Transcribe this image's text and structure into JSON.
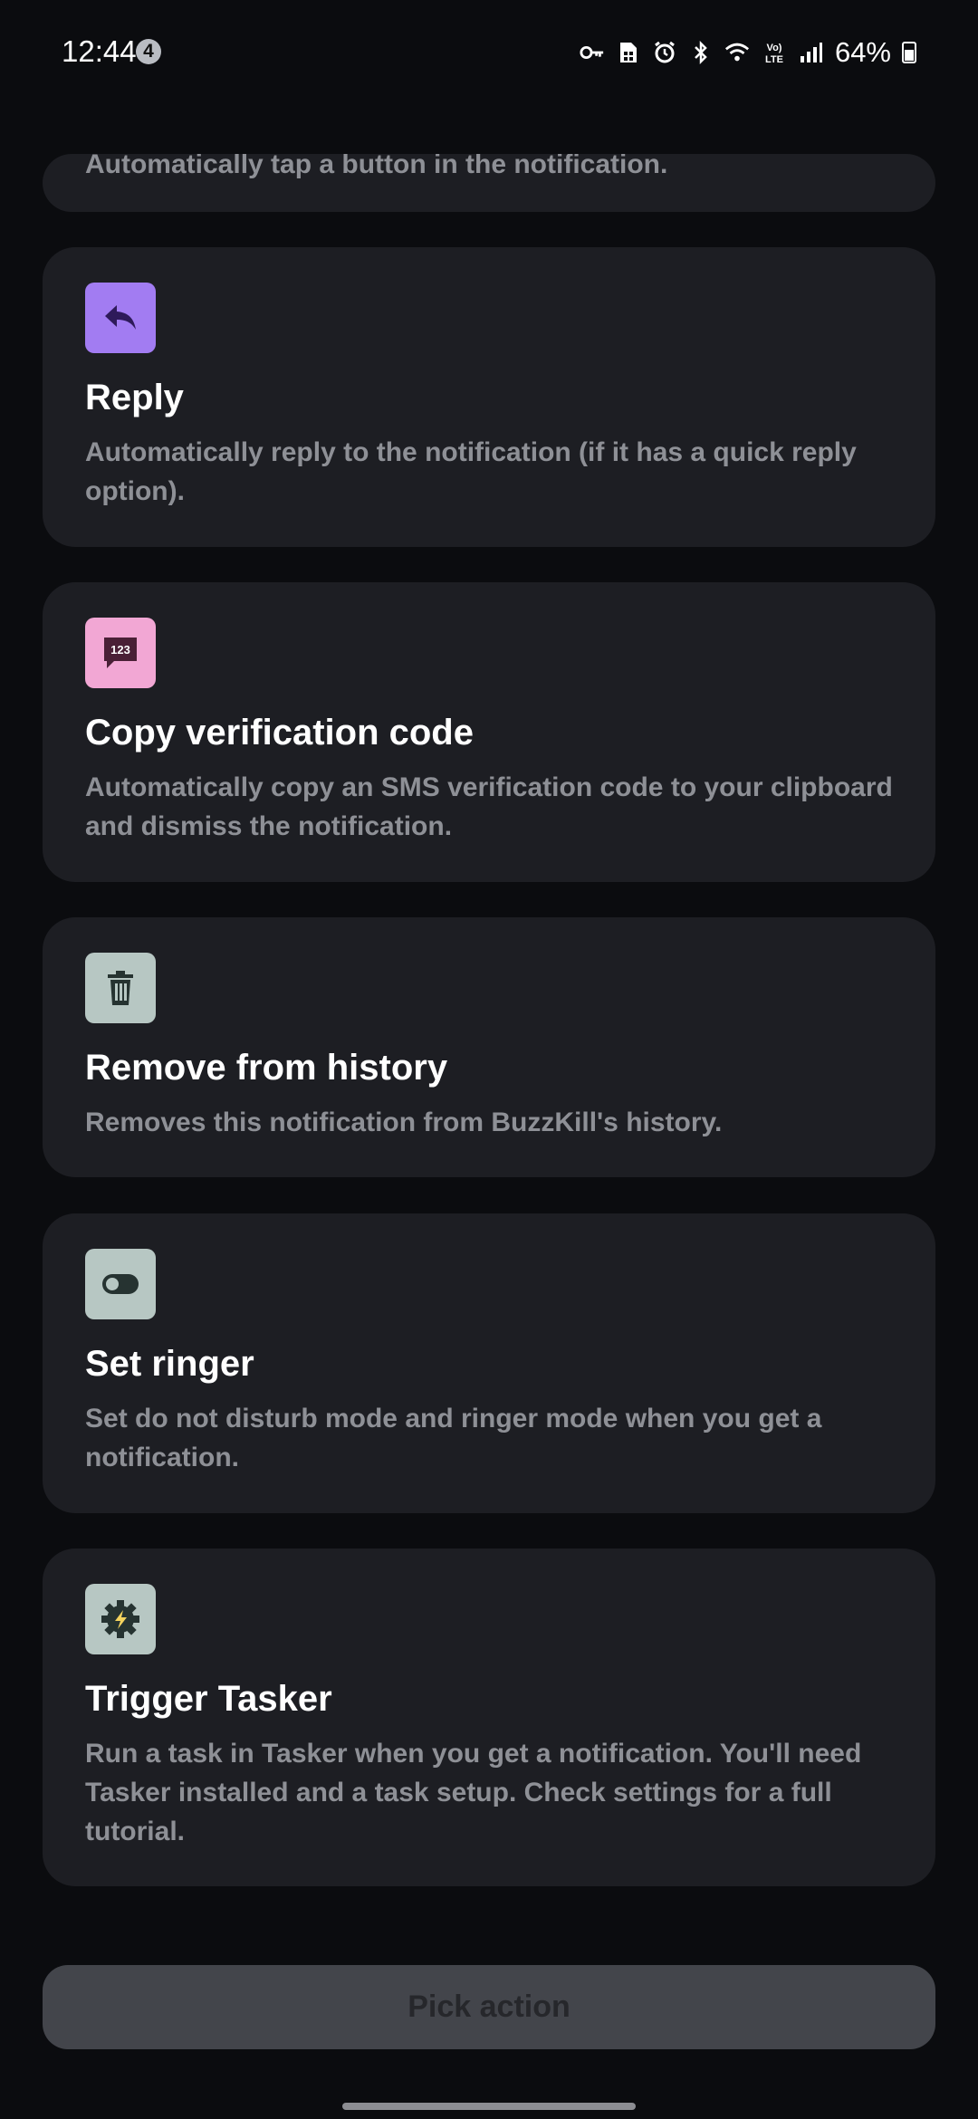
{
  "status_bar": {
    "time": "12:44",
    "notification_count": "4",
    "battery": "64%",
    "icons": [
      "vpn-key-icon",
      "sim-icon",
      "alarm-icon",
      "bluetooth-icon",
      "wifi-icon",
      "volte-icon",
      "signal-icon",
      "battery-icon"
    ],
    "volte_label": "Vo) LTE"
  },
  "partial_card": {
    "description": "Automatically tap a button in the notification."
  },
  "actions": [
    {
      "title": "Reply",
      "description": "Automatically reply to the notification (if it has a quick reply option).",
      "icon": "reply-icon",
      "icon_bg": "#a27cf2",
      "icon_fg": "#2e1a5a"
    },
    {
      "title": "Copy verification code",
      "description": "Automatically copy an SMS verification code to your clipboard and dismiss the notification.",
      "icon": "sms-code-icon",
      "icon_bg": "#f2a7d4",
      "icon_fg": "#4a2036",
      "icon_text": "123"
    },
    {
      "title": "Remove from history",
      "description": "Removes this notification from BuzzKill's history.",
      "icon": "trash-icon",
      "icon_bg": "#b7c7c3",
      "icon_fg": "#263331"
    },
    {
      "title": "Set ringer",
      "description": "Set do not disturb mode and ringer mode when you get a notification.",
      "icon": "toggle-icon",
      "icon_bg": "#b7c7c3",
      "icon_fg": "#263331"
    },
    {
      "title": "Trigger Tasker",
      "description": "Run a task in Tasker when you get a notification. You'll need Tasker installed and a task setup. Check settings for a full tutorial.",
      "icon": "tasker-gear-icon",
      "icon_bg": "#b7c7c3",
      "icon_fg": "#263331"
    }
  ],
  "pick_button": {
    "label": "Pick action"
  },
  "colors": {
    "background": "#0b0c0f",
    "card": "#1d1e23",
    "description_text": "#8e9096",
    "button_bg": "#43454b"
  }
}
